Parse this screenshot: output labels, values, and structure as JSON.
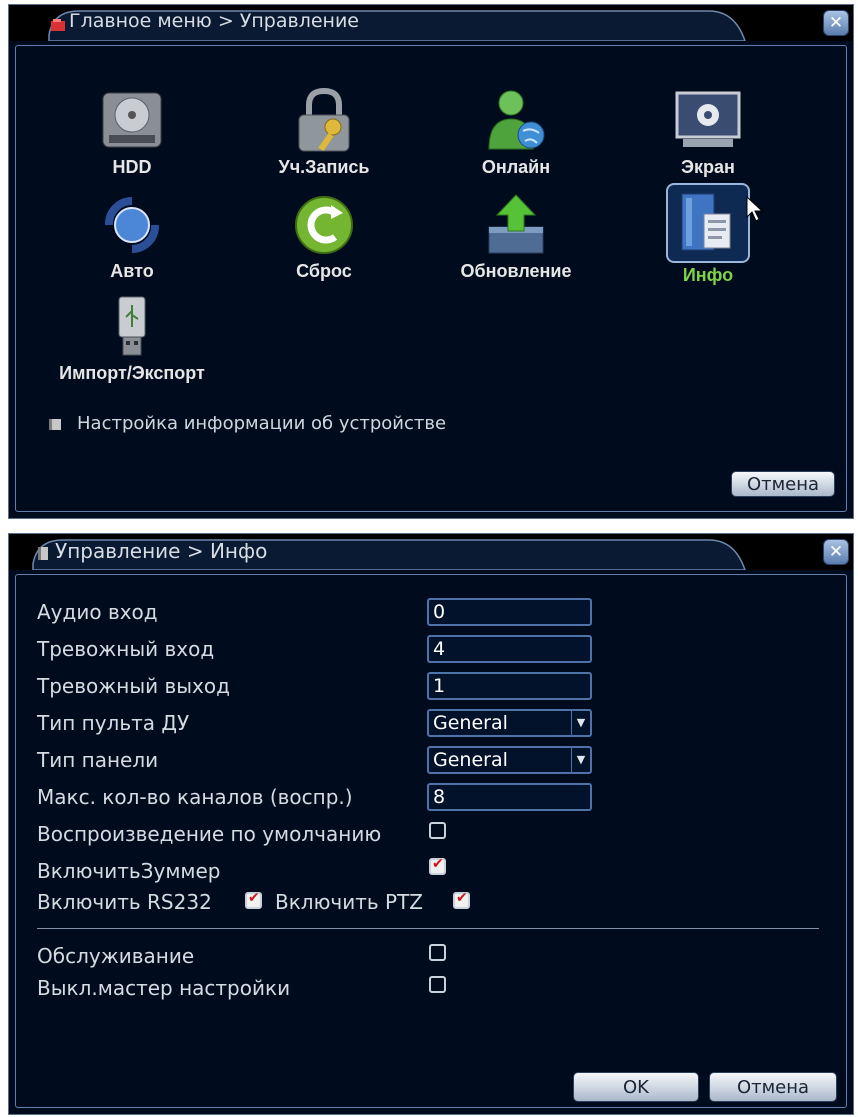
{
  "top": {
    "title": "Главное меню > Управление",
    "close": "✕",
    "items": [
      {
        "label": "HDD",
        "icon": "hdd-icon"
      },
      {
        "label": "Уч.Запись",
        "icon": "lock-key-icon"
      },
      {
        "label": "Онлайн",
        "icon": "online-user-icon"
      },
      {
        "label": "Экран",
        "icon": "screen-gear-icon"
      },
      {
        "label": "Авто",
        "icon": "auto-cycle-icon"
      },
      {
        "label": "Сброс",
        "icon": "reset-icon"
      },
      {
        "label": "Обновление",
        "icon": "upgrade-arrow-icon"
      },
      {
        "label": "Инфо",
        "icon": "info-book-icon",
        "active": true
      },
      {
        "label": "Импорт/Экспорт",
        "icon": "usb-drive-icon"
      }
    ],
    "hint": "Настройка информации об устройстве",
    "cancel": "Отмена"
  },
  "bottom": {
    "title": "Управление > Инфо",
    "close": "✕",
    "fields": {
      "audio_in": {
        "label": "Аудио вход",
        "value": "0"
      },
      "alarm_in": {
        "label": "Тревожный вход",
        "value": "4"
      },
      "alarm_out": {
        "label": "Тревожный выход",
        "value": "1"
      },
      "remote_type": {
        "label": "Тип пульта ДУ",
        "value": "General"
      },
      "panel_type": {
        "label": "Тип панели",
        "value": "General"
      },
      "max_channels": {
        "label": "Макс. кол-во каналов (воспр.)",
        "value": "8"
      },
      "default_playback": {
        "label": "Воспроизведение по умолчанию",
        "checked": false
      },
      "buzzer": {
        "label": "ВключитьЗуммер",
        "checked": true
      },
      "rs232": {
        "label": "Включить RS232",
        "checked": true
      },
      "ptz": {
        "label": "Включить PTZ",
        "checked": true
      },
      "maintenance": {
        "label": "Обслуживание",
        "checked": false
      },
      "wizard_off": {
        "label": "Выкл.мастер настройки",
        "checked": false
      }
    },
    "ok": "OK",
    "cancel": "Отмена"
  },
  "colors": {
    "panel_bg": "#000c1e",
    "border": "#5f7fae",
    "active_label": "#7fd24a",
    "check_mark": "#d01515"
  }
}
